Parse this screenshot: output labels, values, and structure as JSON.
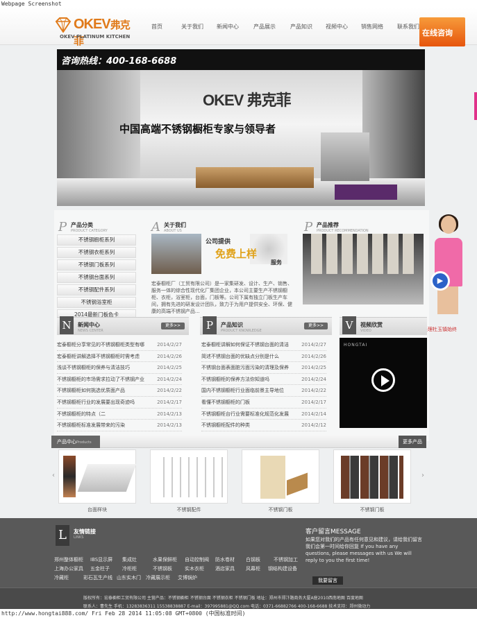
{
  "capture": {
    "top": "Webpage Screenshot",
    "bottom": "http://www.hongtai888.com/ Fri Feb 28 2014 11:05:08 GMT+0800 (中国标准时间)"
  },
  "header": {
    "logo_brand": "OKEV",
    "logo_brand_cn": "弗克菲",
    "logo_sub": "OKEV PLATINUM KITCHEN",
    "nav": [
      "首页",
      "关于我们",
      "新闻中心",
      "产品展示",
      "产品知识",
      "视频中心",
      "销售网络",
      "联系我们"
    ],
    "consult_label": "在线咨询"
  },
  "banner": {
    "hotline": "咨询热线：400-168-6688",
    "logo": "OKEV 弗克菲",
    "slogan": "中国高端不锈钢橱柜专家与领导者"
  },
  "categories": {
    "title": "产品分类",
    "subtitle": "PRODUCT CATEGORY",
    "items": [
      "不锈钢橱柜系列",
      "不锈钢衣柜系列",
      "不锈钢门板系列",
      "不锈钢台面系列",
      "不锈钢配件系列",
      "不锈钢浴室柜",
      "2014最新门板色卡"
    ]
  },
  "about": {
    "title": "关于我们",
    "subtitle": "ABOUT US",
    "promo1": "公司提供",
    "promo2": "免费上样",
    "promo3": "服务",
    "text": "宏泰橱柜厂（工贸有限公司）是一家集研发、设计、生产、销售、服务一体的综合性现代化厂集团企业，本公司主要生产不锈钢橱柜、衣柜，浴室柜，台面，门板等。公司下属有独立门板生产车间，拥有先进的研发设计团队，致力于为用户提供安全、环保、健康的高端不锈钢产品..."
  },
  "recommend": {
    "title": "产品推荐",
    "subtitle": "PRODUCT RECOMMENDATION"
  },
  "spokesperson": {
    "caption": "总经理杜玉镇始终"
  },
  "news": {
    "letter": "N",
    "title": "新闻中心",
    "subtitle": "NEWS CENTER",
    "more": "更多>>",
    "items": [
      {
        "title": "宏泰橱柜分享常见的不锈钢橱柜类型有哪",
        "date": "2014/2/27"
      },
      {
        "title": "宏泰橱柜讲解选择不锈钢橱柜时需考虑",
        "date": "2014/2/26"
      },
      {
        "title": "浅谈不锈钢橱柜的保养与清洁技巧",
        "date": "2014/2/25"
      },
      {
        "title": "不锈钢橱柜的市场需求拉动了不锈钢产业",
        "date": "2014/2/24"
      },
      {
        "title": "不锈钢橱柜如何挑选优质面产品",
        "date": "2014/2/22"
      },
      {
        "title": "不锈钢橱柜行业的发展要出现奇迹吗",
        "date": "2014/2/17"
      },
      {
        "title": "不锈钢橱柜的特点（二",
        "date": "2014/2/13"
      },
      {
        "title": "不锈钢橱柜标准发展带来的污染",
        "date": "2014/2/13"
      }
    ]
  },
  "knowledge": {
    "letter": "P",
    "title": "产品知识",
    "subtitle": "PRODUCT KNOWLEDGE",
    "more": "更多>>",
    "items": [
      {
        "title": "宏泰橱柜讲解如何保证不锈钢台面的清洁",
        "date": "2014/2/27"
      },
      {
        "title": "简述不锈钢台面的优缺点分别是什么",
        "date": "2014/2/26"
      },
      {
        "title": "不锈钢台面表面脏污面污染的清理及保养",
        "date": "2014/2/25"
      },
      {
        "title": "不锈钢橱柜的保养方法你知道吗",
        "date": "2014/2/24"
      },
      {
        "title": "国内不锈钢橱柜行业面临前景主导地位",
        "date": "2014/2/22"
      },
      {
        "title": "看懂不锈钢橱柜的门板",
        "date": "2014/2/17"
      },
      {
        "title": "不锈钢橱柜台行业需要标准化规范化发展",
        "date": "2014/2/14"
      },
      {
        "title": "不锈钢橱柜配件的种类",
        "date": "2014/2/12"
      }
    ]
  },
  "video": {
    "letter": "V",
    "title": "视频欣赏",
    "subtitle": "VIDEO",
    "brand": "HONGTAI"
  },
  "products": {
    "title": "产品中心",
    "title_en": "Products",
    "more": "更多产品",
    "items": [
      "台面样块",
      "不锈钢配件",
      "不锈钢门板",
      "不锈钢门板"
    ]
  },
  "footer": {
    "links_letter": "L",
    "links_title": "友情链接",
    "links_sub": "LINKS",
    "links": [
      [
        "郑州整体橱柜",
        "IBS显示屏",
        "集成灶",
        "水果保鲜柜",
        "自动控制阀",
        "防水卷材",
        "白钢板",
        "不锈钢加工"
      ],
      [
        "上海办公家具",
        "五金柱子",
        "冷柜柜",
        "不锈钢板",
        "实木衣柜",
        "酒店家具",
        "风幕柜",
        "钢结构建设备"
      ],
      [
        "冷藏柜",
        "彩石瓦生产线",
        "山东实木门",
        "冷藏展示柜",
        "艾博锅炉"
      ]
    ],
    "msg_title": "客户留言MESSAGE",
    "msg_text": "如果您对我们的产品有任何意见和建议，请给我们留言我们会第一时间给你回复 If you have any questions, please messages with us We will reply to you the first time!",
    "msg_button": "我要留言",
    "line1": "版权所有：宏泰橱柜工贸有限公司 主营产品：不锈钢橱柜 不锈钢台面 不锈钢衣柜 不锈钢门板 地址：郑州市郑汴路商务大厦A座2010西南地图 百度地图",
    "line2": "联系人：曹先生 手机：13283836311 15538838887 E-mail：397995881@QQ.com 电话：0371-66882766 400-168-6688 技术支持：郑州微动力"
  }
}
